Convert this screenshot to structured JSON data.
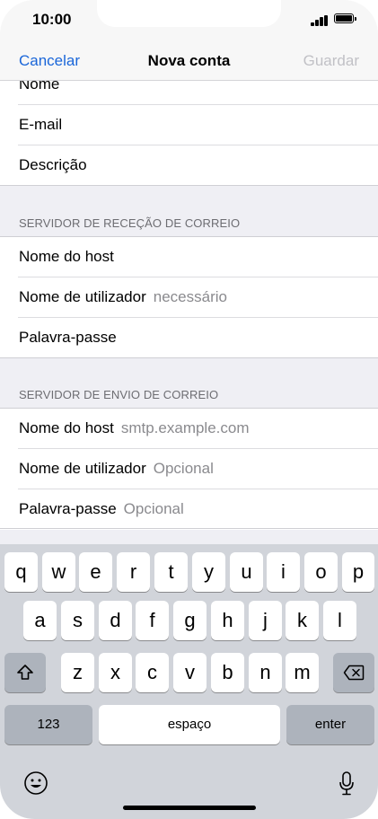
{
  "status_bar": {
    "time": "10:00"
  },
  "nav": {
    "cancel": "Cancelar",
    "title": "Nova conta",
    "save": "Guardar"
  },
  "account": {
    "name_label": "Nome",
    "email_label": "E-mail",
    "description_label": "Descrição"
  },
  "incoming": {
    "header": "SERVIDOR DE RECEÇÃO DE CORREIO",
    "host_label": "Nome do host",
    "username_label": "Nome de utilizador",
    "username_placeholder": "necessário",
    "password_label": "Palavra-passe"
  },
  "outgoing": {
    "header": "SERVIDOR DE ENVIO DE CORREIO",
    "host_label": "Nome do host",
    "host_placeholder": "smtp.example.com",
    "username_label": "Nome de utilizador",
    "username_placeholder": "Opcional",
    "password_label": "Palavra-passe",
    "password_placeholder": "Opcional"
  },
  "keyboard": {
    "row1": [
      "q",
      "w",
      "e",
      "r",
      "t",
      "y",
      "u",
      "i",
      "o",
      "p"
    ],
    "row2": [
      "a",
      "s",
      "d",
      "f",
      "g",
      "h",
      "j",
      "k",
      "l"
    ],
    "row3": [
      "z",
      "x",
      "c",
      "v",
      "b",
      "n",
      "m"
    ],
    "numbers_key": "123",
    "space_key": "espaço",
    "enter_key": "enter",
    "icons": {
      "shift": "shift-icon",
      "backspace": "backspace-icon",
      "emoji": "emoji-icon",
      "mic": "microphone-icon"
    }
  },
  "colors": {
    "accent": "#1a66d9",
    "disabled": "#c1c1c6",
    "placeholder": "#8a8a8e",
    "grouped_bg": "#efeff4",
    "keyboard_bg": "#d1d4da"
  }
}
